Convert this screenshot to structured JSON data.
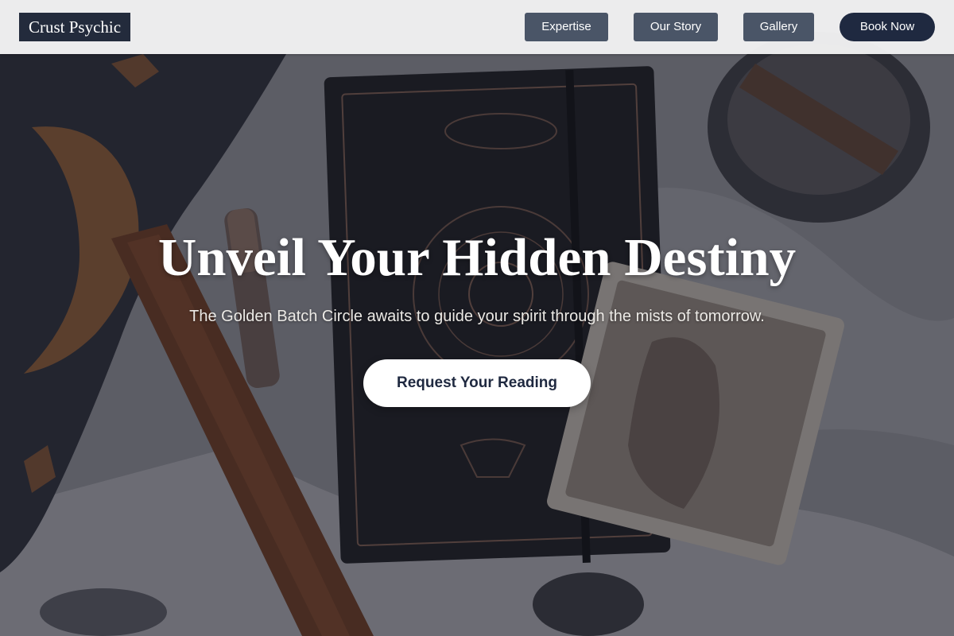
{
  "header": {
    "logo": "Crust Psychic",
    "nav": [
      {
        "label": "Expertise"
      },
      {
        "label": "Our Story"
      },
      {
        "label": "Gallery"
      }
    ],
    "book_label": "Book Now"
  },
  "hero": {
    "title": "Unveil Your Hidden Destiny",
    "subtitle": "The Golden Batch Circle awaits to guide your spirit through the mists of tomorrow.",
    "cta_label": "Request Your Reading",
    "background_icon": "tarot-journal-flatlay-image"
  },
  "colors": {
    "header_bg": "#f2f2f2",
    "logo_bg": "#232b3c",
    "nav_button_bg": "#4a5567",
    "book_button_bg": "#1f2940",
    "cta_bg": "#ffffff",
    "cta_text": "#1f2940"
  }
}
